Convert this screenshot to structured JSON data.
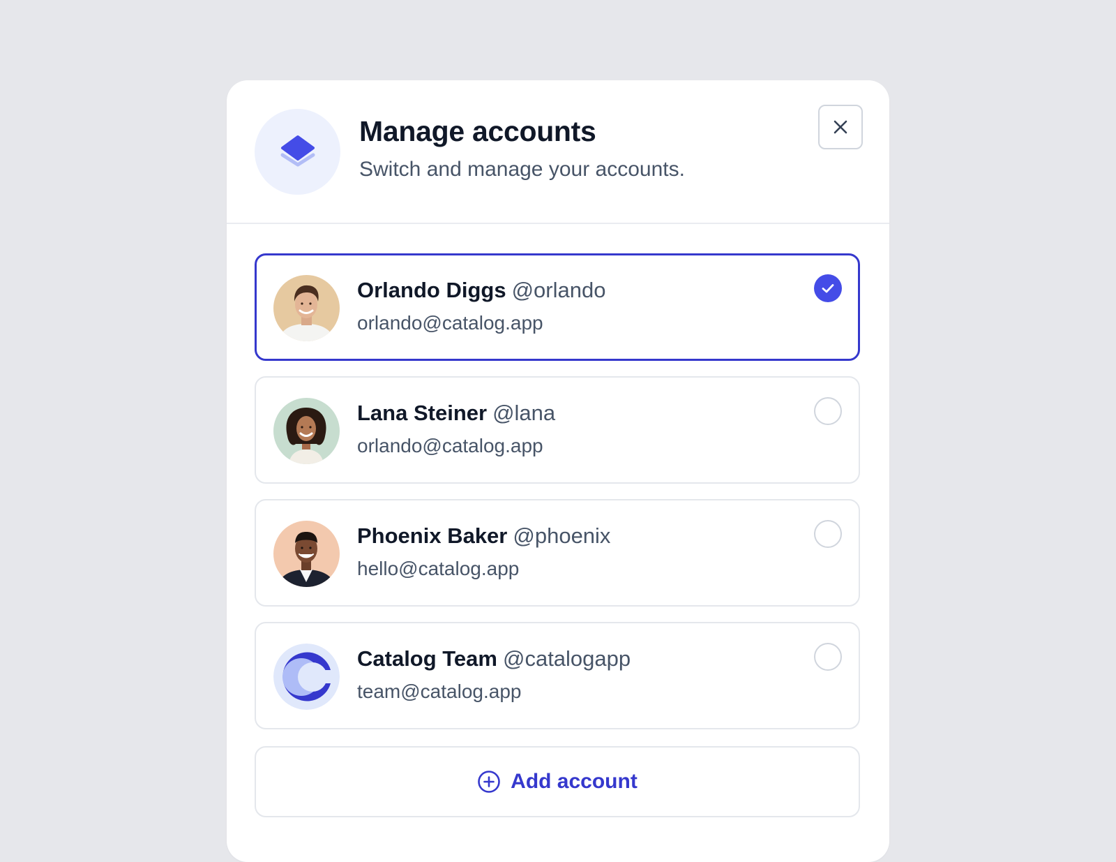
{
  "modal": {
    "title": "Manage accounts",
    "subtitle": "Switch and manage your accounts.",
    "featured_icon": "layers-icon",
    "close_icon": "close-icon"
  },
  "accounts": [
    {
      "name": "Orlando Diggs",
      "handle": "@orlando",
      "email": "orlando@catalog.app",
      "selected": true,
      "avatar": "avatar-photo-orlando"
    },
    {
      "name": "Lana Steiner",
      "handle": "@lana",
      "email": "orlando@catalog.app",
      "selected": false,
      "avatar": "avatar-photo-lana"
    },
    {
      "name": "Phoenix Baker",
      "handle": "@phoenix",
      "email": "hello@catalog.app",
      "selected": false,
      "avatar": "avatar-photo-phoenix"
    },
    {
      "name": "Catalog Team",
      "handle": "@catalogapp",
      "email": "team@catalog.app",
      "selected": false,
      "avatar": "catalog-logo"
    }
  ],
  "add_account": {
    "label": "Add account",
    "icon": "plus-circle-icon"
  },
  "colors": {
    "background": "#e6e7eb",
    "accent": "#444ce7",
    "accent_dark": "#3538cd",
    "border": "#e4e7ec",
    "text_primary": "#101828",
    "text_secondary": "#475467"
  }
}
